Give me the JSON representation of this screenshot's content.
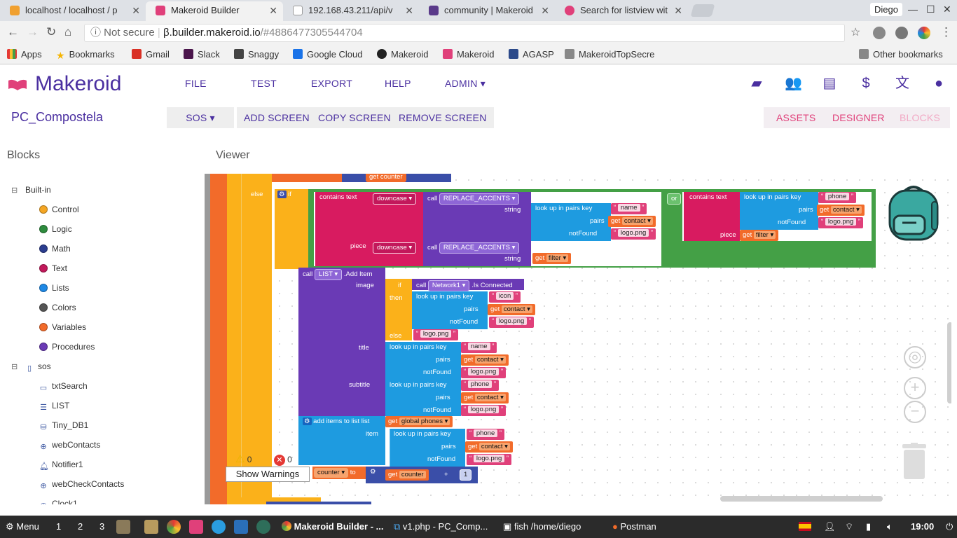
{
  "browser": {
    "tabs": [
      {
        "label": "localhost / localhost / p",
        "active": false
      },
      {
        "label": "Makeroid Builder",
        "active": true
      },
      {
        "label": "192.168.43.211/api/v",
        "active": false
      },
      {
        "label": "community | Makeroid",
        "active": false
      },
      {
        "label": "Search for listview wit",
        "active": false
      }
    ],
    "profile": "Diego",
    "address": {
      "insecure": "Not secure",
      "host": "β.builder.makeroid.io",
      "path": "/#4886477305544704"
    },
    "bookmarks": [
      "Apps",
      "Bookmarks",
      "Gmail",
      "Slack",
      "Snaggy",
      "Google Cloud",
      "Makeroid",
      "Makeroid",
      "AGASP",
      "MakeroidTopSecre",
      "Other bookmarks"
    ]
  },
  "app": {
    "brand": "Makeroid",
    "menu": [
      "FILE",
      "TEST",
      "EXPORT",
      "HELP",
      "ADMIN ▾"
    ],
    "project": "PC_Compostela",
    "screen_selector": "SOS ▾",
    "screen_buttons": [
      "ADD SCREEN",
      "COPY SCREEN",
      "REMOVE SCREEN"
    ],
    "view_buttons": [
      "ASSETS",
      "DESIGNER",
      "BLOCKS"
    ],
    "blocks_title": "Blocks",
    "viewer_title": "Viewer"
  },
  "tree": {
    "builtin_label": "Built-in",
    "builtin": [
      {
        "label": "Control",
        "color": "#f5a623"
      },
      {
        "label": "Logic",
        "color": "#2e8b3e"
      },
      {
        "label": "Math",
        "color": "#2b3d8f"
      },
      {
        "label": "Text",
        "color": "#c2185b"
      },
      {
        "label": "Lists",
        "color": "#1e88e5"
      },
      {
        "label": "Colors",
        "color": "#555555"
      },
      {
        "label": "Variables",
        "color": "#f26b2a"
      },
      {
        "label": "Procedures",
        "color": "#6a3ab5"
      }
    ],
    "screen_label": "sos",
    "components": [
      "txtSearch",
      "LIST",
      "Tiny_DB1",
      "webContacts",
      "Notifier1",
      "webCheckContacts",
      "Clock1"
    ]
  },
  "blocks": {
    "else_kw": "else",
    "if_kw": "if",
    "then_kw": "then",
    "or_kw": "or",
    "contains_text": "contains  text",
    "downcase": "downcase ▾",
    "call": "call",
    "replace_accents": "REPLACE_ACCENTS ▾",
    "string": "string",
    "piece": "piece",
    "lookup_key": "look up in pairs  key",
    "pairs": "pairs",
    "notfound": "notFound",
    "get_contact": "contact ▾",
    "get_filter": "filter ▾",
    "get": "get",
    "name": "name",
    "phone": "phone",
    "icon": "icon",
    "logo": "logo.png",
    "list_comp": "LIST ▾",
    "add_item": ".Add Item",
    "image": "image",
    "network": "Network1 ▾",
    "is_connected": ".Is Connected",
    "title": "title",
    "subtitle": "subtitle",
    "add_items_to_list": "add items to list  list",
    "global_phones": "global phones ▾",
    "item": "item",
    "counter": "counter ▾",
    "to": "to",
    "plus": "+",
    "one": "1",
    "top_counter": "counter"
  },
  "warnings": {
    "warn_count": "0",
    "error_count": "0",
    "button": "Show Warnings"
  },
  "taskbar": {
    "menu": "Menu",
    "workspaces": [
      "1",
      "2",
      "3"
    ],
    "apps": [
      "Makeroid Builder - ...",
      "v1.php - PC_Comp...",
      "fish  /home/diego",
      "Postman"
    ],
    "time": "19:00"
  }
}
